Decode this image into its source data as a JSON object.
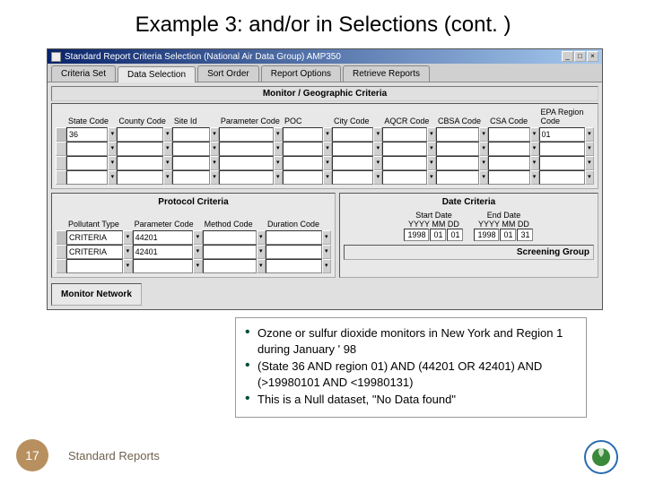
{
  "slide": {
    "title": "Example 3: and/or in Selections (cont. )"
  },
  "window": {
    "title": "Standard Report Criteria Selection (National Air Data Group) AMP350",
    "minimize": "_",
    "maximize": "□",
    "close": "×"
  },
  "tabs": {
    "t1": "Criteria Set",
    "t2": "Data Selection",
    "t3": "Sort Order",
    "t4": "Report Options",
    "t5": "Retrieve Reports"
  },
  "monitor": {
    "title": "Monitor / Geographic Criteria",
    "headers": {
      "state": "State Code",
      "county": "County Code",
      "site": "Site Id",
      "param": "Parameter Code",
      "poc": "POC",
      "city": "City Code",
      "aqcr": "AQCR Code",
      "cbsa": "CBSA Code",
      "csa": "CSA Code",
      "region": "EPA Region Code"
    },
    "row1": {
      "state": "36",
      "region": "01"
    }
  },
  "protocol": {
    "title": "Protocol Criteria",
    "headers": {
      "ptype": "Pollutant Type",
      "pcode": "Parameter Code",
      "method": "Method Code",
      "duration": "Duration Code"
    },
    "r1": {
      "ptype": "CRITERIA",
      "pcode": "44201"
    },
    "r2": {
      "ptype": "CRITERIA",
      "pcode": "42401"
    }
  },
  "date": {
    "title": "Date Criteria",
    "start_label": "Start Date",
    "end_label": "End Date",
    "fmt": "YYYY MM DD",
    "start": {
      "y": "1998",
      "m": "01",
      "d": "01"
    },
    "end": {
      "y": "1998",
      "m": "01",
      "d": "31"
    }
  },
  "screening_title": "Screening Group",
  "network_title": "Monitor Network",
  "overlay": {
    "b1": "Ozone or sulfur dioxide monitors in New York and Region 1 during January ' 98",
    "b2": "(State 36 AND region 01) AND (44201 OR 42401) AND  (>19980101 AND <19980131)",
    "b3": "This is a Null dataset, \"No Data found\""
  },
  "footer": {
    "page": "17",
    "text": "Standard Reports"
  }
}
